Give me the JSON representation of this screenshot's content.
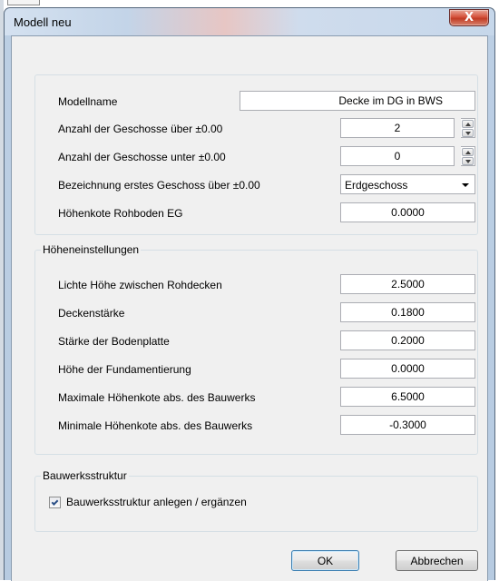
{
  "window": {
    "title": "Modell neu",
    "close_label": "X"
  },
  "general": {
    "modellname_label": "Modellname",
    "modellname_value": "Decke im DG in BWS",
    "geschosse_ueber_label": "Anzahl der Geschosse über ±0.00",
    "geschosse_ueber_value": "2",
    "geschosse_unter_label": "Anzahl der Geschosse unter ±0.00",
    "geschosse_unter_value": "0",
    "erstes_geschoss_label": "Bezeichnung erstes Geschoss über ±0.00",
    "erstes_geschoss_value": "Erdgeschoss",
    "hoehenkote_label": "Höhenkote Rohboden EG",
    "hoehenkote_value": "0.0000"
  },
  "hoehen": {
    "legend": "Höheneinstellungen",
    "rows": [
      {
        "label": "Lichte Höhe zwischen Rohdecken",
        "value": "2.5000"
      },
      {
        "label": "Deckenstärke",
        "value": "0.1800"
      },
      {
        "label": "Stärke der Bodenplatte",
        "value": "0.2000"
      },
      {
        "label": "Höhe der Fundamentierung",
        "value": "0.0000"
      },
      {
        "label": "Maximale Höhenkote abs. des Bauwerks",
        "value": "6.5000"
      },
      {
        "label": "Minimale Höhenkote abs. des Bauwerks",
        "value": "-0.3000"
      }
    ]
  },
  "struktur": {
    "legend": "Bauwerksstruktur",
    "checkbox_label": "Bauwerksstruktur anlegen / ergänzen",
    "checked": true
  },
  "buttons": {
    "ok": "OK",
    "cancel": "Abbrechen"
  }
}
